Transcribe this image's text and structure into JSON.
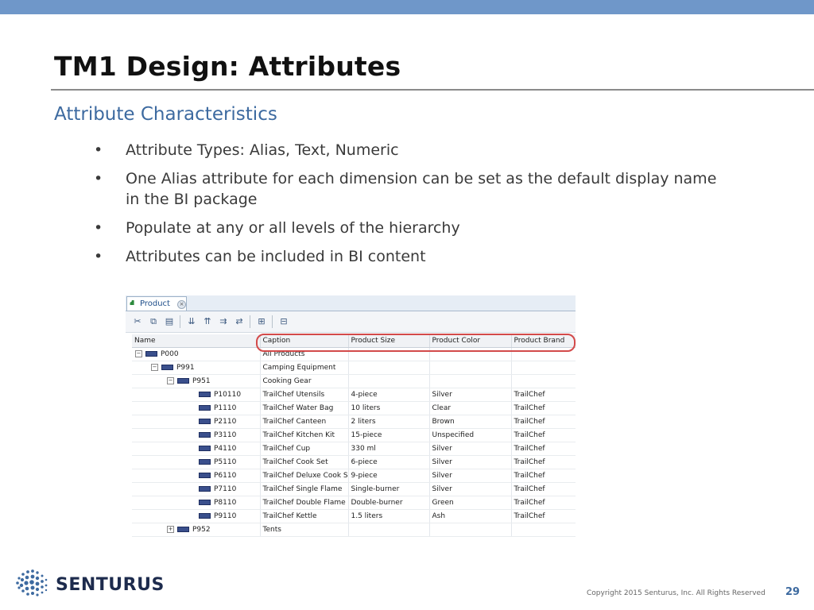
{
  "slide": {
    "title": "TM1 Design: Attributes",
    "subtitle": "Attribute Characteristics",
    "bullets": [
      {
        "bullet": "•",
        "text": "Attribute Types: Alias, Text, Numeric"
      },
      {
        "bullet": "•",
        "text": "One Alias attribute for each dimension can be set as the default display name in the BI package"
      },
      {
        "bullet": "•",
        "text": "Populate at any or all levels of the hierarchy"
      },
      {
        "bullet": "•",
        "text": "Attributes can be included in BI content"
      }
    ],
    "colors": {
      "accent_bar": "#6f97c9",
      "subtitle": "#3d6aa0",
      "highlight": "#d34a4a"
    }
  },
  "editor": {
    "tab": {
      "label": "Product",
      "icon": "hierarchy-icon",
      "close": "×"
    },
    "toolbar": [
      {
        "icon": "cut-icon",
        "glyph": "✂"
      },
      {
        "icon": "copy-icon",
        "glyph": "⧉"
      },
      {
        "icon": "paste-icon",
        "glyph": "▤"
      },
      {
        "icon": "sort-descending-icon",
        "glyph": "⇊"
      },
      {
        "icon": "sort-ascending-icon",
        "glyph": "⇈"
      },
      {
        "icon": "sort-hierarchy-icon",
        "glyph": "⇉"
      },
      {
        "icon": "sort-reverse-icon",
        "glyph": "⇄"
      },
      {
        "icon": "expand-icon",
        "glyph": "⊞"
      },
      {
        "icon": "filter-icon",
        "glyph": "⊟"
      }
    ],
    "columns": [
      "Name",
      "Caption",
      "Product Size",
      "Product Color",
      "Product Brand"
    ],
    "rows": [
      {
        "level": 0,
        "expander": "−",
        "name": "P000",
        "caption": "All Products",
        "size": "",
        "color": "",
        "brand": ""
      },
      {
        "level": 1,
        "expander": "−",
        "name": "P991",
        "caption": "Camping Equipment",
        "size": "",
        "color": "",
        "brand": ""
      },
      {
        "level": 2,
        "expander": "−",
        "name": "P951",
        "caption": "Cooking Gear",
        "size": "",
        "color": "",
        "brand": ""
      },
      {
        "level": 3,
        "expander": "",
        "name": "P10110",
        "caption": "TrailChef Utensils",
        "size": "4-piece",
        "color": "Silver",
        "brand": "TrailChef"
      },
      {
        "level": 3,
        "expander": "",
        "name": "P1110",
        "caption": "TrailChef Water Bag",
        "size": "10 liters",
        "color": "Clear",
        "brand": "TrailChef"
      },
      {
        "level": 3,
        "expander": "",
        "name": "P2110",
        "caption": "TrailChef Canteen",
        "size": "2 liters",
        "color": "Brown",
        "brand": "TrailChef"
      },
      {
        "level": 3,
        "expander": "",
        "name": "P3110",
        "caption": "TrailChef Kitchen Kit",
        "size": "15-piece",
        "color": "Unspecified",
        "brand": "TrailChef"
      },
      {
        "level": 3,
        "expander": "",
        "name": "P4110",
        "caption": "TrailChef Cup",
        "size": "330 ml",
        "color": "Silver",
        "brand": "TrailChef"
      },
      {
        "level": 3,
        "expander": "",
        "name": "P5110",
        "caption": "TrailChef Cook Set",
        "size": "6-piece",
        "color": "Silver",
        "brand": "TrailChef"
      },
      {
        "level": 3,
        "expander": "",
        "name": "P6110",
        "caption": "TrailChef Deluxe Cook Set",
        "size": "9-piece",
        "color": "Silver",
        "brand": "TrailChef"
      },
      {
        "level": 3,
        "expander": "",
        "name": "P7110",
        "caption": "TrailChef Single Flame",
        "size": "Single-burner",
        "color": "Silver",
        "brand": "TrailChef"
      },
      {
        "level": 3,
        "expander": "",
        "name": "P8110",
        "caption": "TrailChef Double Flame",
        "size": "Double-burner",
        "color": "Green",
        "brand": "TrailChef"
      },
      {
        "level": 3,
        "expander": "",
        "name": "P9110",
        "caption": "TrailChef Kettle",
        "size": "1.5 liters",
        "color": "Ash",
        "brand": "TrailChef"
      },
      {
        "level": 2,
        "expander": "+",
        "name": "P952",
        "caption": "Tents",
        "size": "",
        "color": "",
        "brand": ""
      }
    ]
  },
  "footer": {
    "logo_text": "SENTURUS",
    "copyright": "Copyright 2015  Senturus, Inc.   All Rights Reserved",
    "page_number": "29"
  }
}
